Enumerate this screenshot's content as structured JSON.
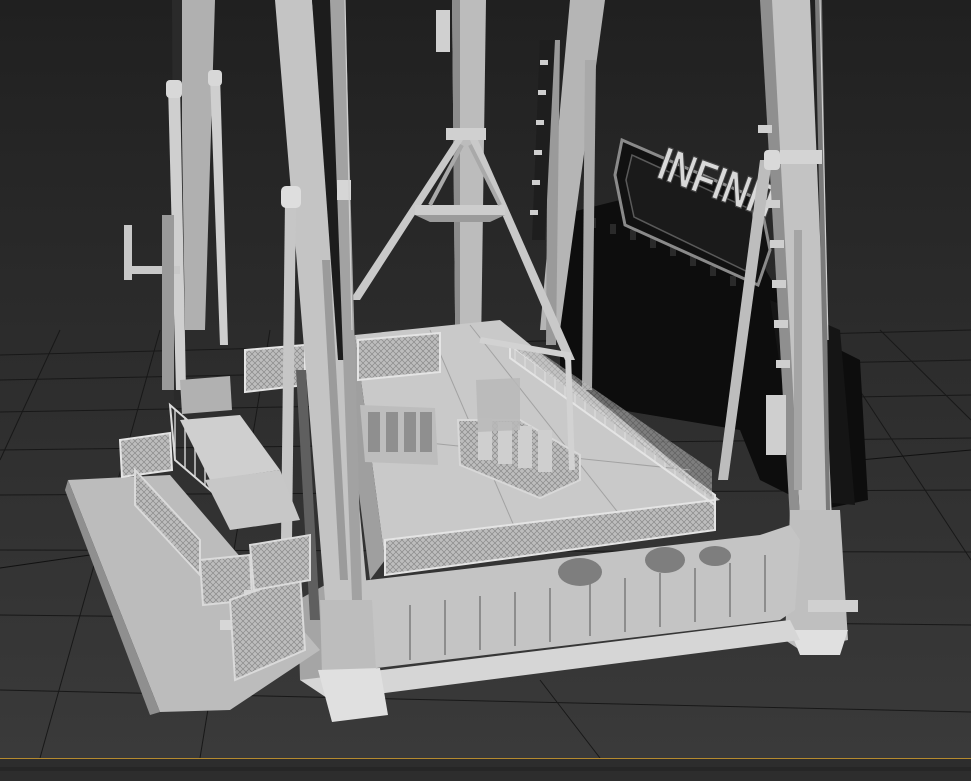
{
  "viewport": {
    "sign_text": "INFINITY",
    "colors": {
      "background_top": "#202020",
      "background_bottom": "#3a3a3a",
      "grid_line": "#171717",
      "model_light": "#cfcfcf",
      "model_mid": "#a8a8a8",
      "model_dark": "#6f6f6f",
      "backdrop_panel": "#0d0d0d",
      "timeline_accent": "#b58a2f"
    }
  }
}
